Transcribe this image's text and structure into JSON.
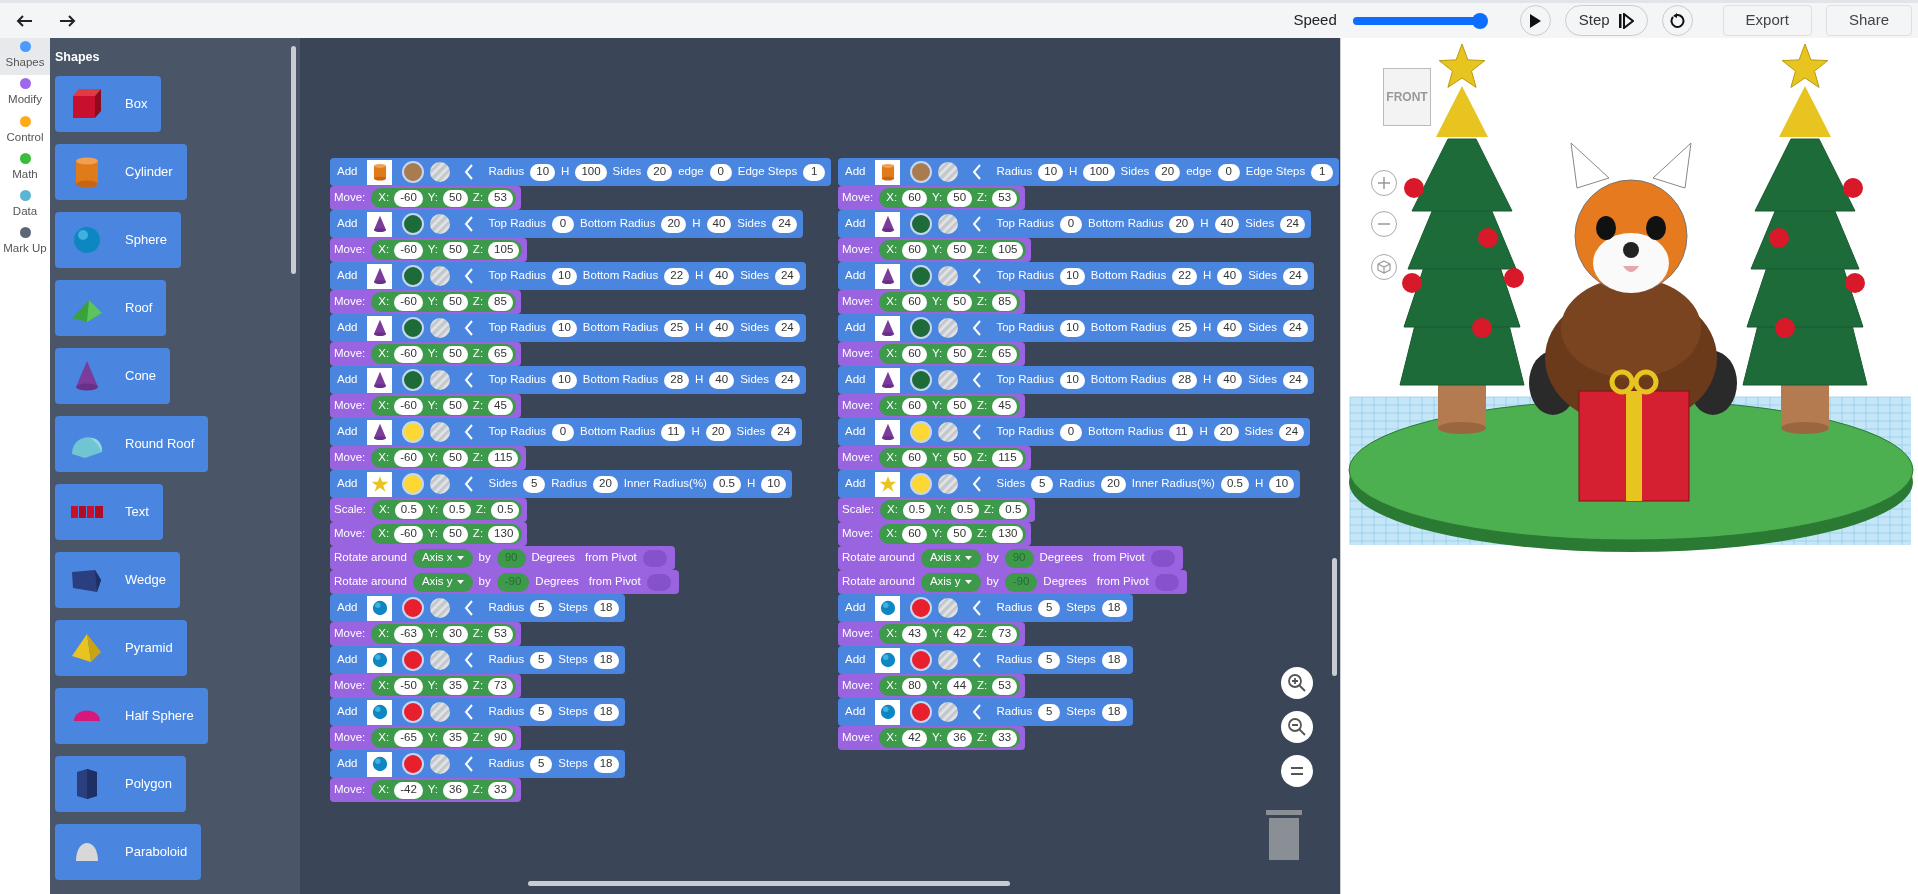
{
  "toolbar": {
    "speed": {
      "label": "Speed",
      "level": 1
    },
    "step": {
      "label": "Step"
    },
    "export": {
      "label": "Export"
    },
    "share": {
      "label": "Share"
    }
  },
  "categories": [
    {
      "label": "Shapes",
      "color": "#4c9aff",
      "selected": true
    },
    {
      "label": "Modify",
      "color": "#a066f0",
      "selected": false
    },
    {
      "label": "Control",
      "color": "#ffab19",
      "selected": false
    },
    {
      "label": "Math",
      "color": "#3dbb3d",
      "selected": false
    },
    {
      "label": "Data",
      "color": "#5bb5d5",
      "selected": false
    },
    {
      "label": "Mark Up",
      "color": "#5b6677",
      "selected": false
    }
  ],
  "palette": {
    "title": "Shapes",
    "items": [
      {
        "label": "Box",
        "icon": {
          "kind": "box"
        }
      },
      {
        "label": "Cylinder",
        "icon": {
          "kind": "cylinder"
        }
      },
      {
        "label": "Sphere",
        "icon": {
          "kind": "sphere"
        }
      },
      {
        "label": "Roof",
        "icon": {
          "kind": "roof"
        }
      },
      {
        "label": "Cone",
        "icon": {
          "kind": "cone"
        }
      },
      {
        "label": "Round Roof",
        "icon": {
          "kind": "roundroof"
        }
      },
      {
        "label": "Text",
        "icon": {
          "kind": "text"
        }
      },
      {
        "label": "Wedge",
        "icon": {
          "kind": "wedge"
        }
      },
      {
        "label": "Pyramid",
        "icon": {
          "kind": "pyramid"
        }
      },
      {
        "label": "Half Sphere",
        "icon": {
          "kind": "halfsphere"
        }
      },
      {
        "label": "Polygon",
        "icon": {
          "kind": "polygon"
        }
      },
      {
        "label": "Paraboloid",
        "icon": {
          "kind": "paraboloid"
        }
      }
    ]
  },
  "stacks": [
    {
      "blocks": [
        {
          "kind": "add",
          "label": "Add",
          "thumbnail": {
            "kind": "cylinder"
          },
          "color": "#a97c50",
          "params": [
            {
              "label": "Radius",
              "value": "10"
            },
            {
              "label": "H",
              "value": "100"
            },
            {
              "label": "Sides",
              "value": "20"
            },
            {
              "label": "edge",
              "value": "0"
            },
            {
              "label": "Edge Steps",
              "value": "1"
            }
          ]
        },
        {
          "kind": "move",
          "label": "Move:",
          "fields": [
            {
              "label": "X:",
              "value": "-60"
            },
            {
              "label": "Y:",
              "value": "50"
            },
            {
              "label": "Z:",
              "value": "53"
            }
          ]
        },
        {
          "kind": "add",
          "label": "Add",
          "thumbnail": {
            "kind": "cone"
          },
          "color": "#1e6b3a",
          "params": [
            {
              "label": "Top Radius",
              "value": "0"
            },
            {
              "label": "Bottom Radius",
              "value": "20"
            },
            {
              "label": "H",
              "value": "40"
            },
            {
              "label": "Sides",
              "value": "24"
            }
          ]
        },
        {
          "kind": "move",
          "label": "Move:",
          "fields": [
            {
              "label": "X:",
              "value": "-60"
            },
            {
              "label": "Y:",
              "value": "50"
            },
            {
              "label": "Z:",
              "value": "105"
            }
          ]
        },
        {
          "kind": "add",
          "label": "Add",
          "thumbnail": {
            "kind": "cone"
          },
          "color": "#1e6b3a",
          "params": [
            {
              "label": "Top Radius",
              "value": "10"
            },
            {
              "label": "Bottom Radius",
              "value": "22"
            },
            {
              "label": "H",
              "value": "40"
            },
            {
              "label": "Sides",
              "value": "24"
            }
          ]
        },
        {
          "kind": "move",
          "label": "Move:",
          "fields": [
            {
              "label": "X:",
              "value": "-60"
            },
            {
              "label": "Y:",
              "value": "50"
            },
            {
              "label": "Z:",
              "value": "85"
            }
          ]
        },
        {
          "kind": "add",
          "label": "Add",
          "thumbnail": {
            "kind": "cone"
          },
          "color": "#1e6b3a",
          "params": [
            {
              "label": "Top Radius",
              "value": "10"
            },
            {
              "label": "Bottom Radius",
              "value": "25"
            },
            {
              "label": "H",
              "value": "40"
            },
            {
              "label": "Sides",
              "value": "24"
            }
          ]
        },
        {
          "kind": "move",
          "label": "Move:",
          "fields": [
            {
              "label": "X:",
              "value": "-60"
            },
            {
              "label": "Y:",
              "value": "50"
            },
            {
              "label": "Z:",
              "value": "65"
            }
          ]
        },
        {
          "kind": "add",
          "label": "Add",
          "thumbnail": {
            "kind": "cone"
          },
          "color": "#1e6b3a",
          "params": [
            {
              "label": "Top Radius",
              "value": "10"
            },
            {
              "label": "Bottom Radius",
              "value": "28"
            },
            {
              "label": "H",
              "value": "40"
            },
            {
              "label": "Sides",
              "value": "24"
            }
          ]
        },
        {
          "kind": "move",
          "label": "Move:",
          "fields": [
            {
              "label": "X:",
              "value": "-60"
            },
            {
              "label": "Y:",
              "value": "50"
            },
            {
              "label": "Z:",
              "value": "45"
            }
          ]
        },
        {
          "kind": "add",
          "label": "Add",
          "thumbnail": {
            "kind": "cone"
          },
          "color": "#fdd835",
          "params": [
            {
              "label": "Top Radius",
              "value": "0"
            },
            {
              "label": "Bottom Radius",
              "value": "11"
            },
            {
              "label": "H",
              "value": "20"
            },
            {
              "label": "Sides",
              "value": "24"
            }
          ]
        },
        {
          "kind": "move",
          "label": "Move:",
          "fields": [
            {
              "label": "X:",
              "value": "-60"
            },
            {
              "label": "Y:",
              "value": "50"
            },
            {
              "label": "Z:",
              "value": "115"
            }
          ]
        },
        {
          "kind": "add",
          "label": "Add",
          "thumbnail": {
            "kind": "star"
          },
          "color": "#fdd835",
          "params": [
            {
              "label": "Sides",
              "value": "5"
            },
            {
              "label": "Radius",
              "value": "20"
            },
            {
              "label": "Inner Radius(%)",
              "value": "0.5"
            },
            {
              "label": "H",
              "value": "10"
            }
          ]
        },
        {
          "kind": "move",
          "label": "Scale:",
          "fields": [
            {
              "label": "X:",
              "value": "0.5"
            },
            {
              "label": "Y:",
              "value": "0.5"
            },
            {
              "label": "Z:",
              "value": "0.5"
            }
          ]
        },
        {
          "kind": "move",
          "label": "Move:",
          "fields": [
            {
              "label": "X:",
              "value": "-60"
            },
            {
              "label": "Y:",
              "value": "50"
            },
            {
              "label": "Z:",
              "value": "130"
            }
          ]
        },
        {
          "kind": "rotate",
          "label": "Rotate around",
          "axis": "Axis x",
          "by": "by",
          "degrees": "90",
          "unit": "Degrees",
          "pivot": "from Pivot"
        },
        {
          "kind": "rotate",
          "label": "Rotate around",
          "axis": "Axis y",
          "by": "by",
          "degrees": "-90",
          "unit": "Degrees",
          "pivot": "from Pivot"
        },
        {
          "kind": "add",
          "label": "Add",
          "thumbnail": {
            "kind": "sphere"
          },
          "color": "#e8202e",
          "params": [
            {
              "label": "Radius",
              "value": "5"
            },
            {
              "label": "Steps",
              "value": "18"
            }
          ]
        },
        {
          "kind": "move",
          "label": "Move:",
          "fields": [
            {
              "label": "X:",
              "value": "-63"
            },
            {
              "label": "Y:",
              "value": "30"
            },
            {
              "label": "Z:",
              "value": "53"
            }
          ]
        },
        {
          "kind": "add",
          "label": "Add",
          "thumbnail": {
            "kind": "sphere"
          },
          "color": "#e8202e",
          "params": [
            {
              "label": "Radius",
              "value": "5"
            },
            {
              "label": "Steps",
              "value": "18"
            }
          ]
        },
        {
          "kind": "move",
          "label": "Move:",
          "fields": [
            {
              "label": "X:",
              "value": "-50"
            },
            {
              "label": "Y:",
              "value": "35"
            },
            {
              "label": "Z:",
              "value": "73"
            }
          ]
        },
        {
          "kind": "add",
          "label": "Add",
          "thumbnail": {
            "kind": "sphere"
          },
          "color": "#e8202e",
          "params": [
            {
              "label": "Radius",
              "value": "5"
            },
            {
              "label": "Steps",
              "value": "18"
            }
          ]
        },
        {
          "kind": "move",
          "label": "Move:",
          "fields": [
            {
              "label": "X:",
              "value": "-65"
            },
            {
              "label": "Y:",
              "value": "35"
            },
            {
              "label": "Z:",
              "value": "90"
            }
          ]
        },
        {
          "kind": "add",
          "label": "Add",
          "thumbnail": {
            "kind": "sphere"
          },
          "color": "#e8202e",
          "params": [
            {
              "label": "Radius",
              "value": "5"
            },
            {
              "label": "Steps",
              "value": "18"
            }
          ]
        },
        {
          "kind": "move",
          "label": "Move:",
          "fields": [
            {
              "label": "X:",
              "value": "-42"
            },
            {
              "label": "Y:",
              "value": "36"
            },
            {
              "label": "Z:",
              "value": "33"
            }
          ]
        }
      ]
    },
    {
      "blocks": [
        {
          "kind": "add",
          "label": "Add",
          "thumbnail": {
            "kind": "cylinder"
          },
          "color": "#a97c50",
          "params": [
            {
              "label": "Radius",
              "value": "10"
            },
            {
              "label": "H",
              "value": "100"
            },
            {
              "label": "Sides",
              "value": "20"
            },
            {
              "label": "edge",
              "value": "0"
            },
            {
              "label": "Edge Steps",
              "value": "1"
            }
          ]
        },
        {
          "kind": "move",
          "label": "Move:",
          "fields": [
            {
              "label": "X:",
              "value": "60"
            },
            {
              "label": "Y:",
              "value": "50"
            },
            {
              "label": "Z:",
              "value": "53"
            }
          ]
        },
        {
          "kind": "add",
          "label": "Add",
          "thumbnail": {
            "kind": "cone"
          },
          "color": "#1e6b3a",
          "params": [
            {
              "label": "Top Radius",
              "value": "0"
            },
            {
              "label": "Bottom Radius",
              "value": "20"
            },
            {
              "label": "H",
              "value": "40"
            },
            {
              "label": "Sides",
              "value": "24"
            }
          ]
        },
        {
          "kind": "move",
          "label": "Move:",
          "fields": [
            {
              "label": "X:",
              "value": "60"
            },
            {
              "label": "Y:",
              "value": "50"
            },
            {
              "label": "Z:",
              "value": "105"
            }
          ]
        },
        {
          "kind": "add",
          "label": "Add",
          "thumbnail": {
            "kind": "cone"
          },
          "color": "#1e6b3a",
          "params": [
            {
              "label": "Top Radius",
              "value": "10"
            },
            {
              "label": "Bottom Radius",
              "value": "22"
            },
            {
              "label": "H",
              "value": "40"
            },
            {
              "label": "Sides",
              "value": "24"
            }
          ]
        },
        {
          "kind": "move",
          "label": "Move:",
          "fields": [
            {
              "label": "X:",
              "value": "60"
            },
            {
              "label": "Y:",
              "value": "50"
            },
            {
              "label": "Z:",
              "value": "85"
            }
          ]
        },
        {
          "kind": "add",
          "label": "Add",
          "thumbnail": {
            "kind": "cone"
          },
          "color": "#1e6b3a",
          "params": [
            {
              "label": "Top Radius",
              "value": "10"
            },
            {
              "label": "Bottom Radius",
              "value": "25"
            },
            {
              "label": "H",
              "value": "40"
            },
            {
              "label": "Sides",
              "value": "24"
            }
          ]
        },
        {
          "kind": "move",
          "label": "Move:",
          "fields": [
            {
              "label": "X:",
              "value": "60"
            },
            {
              "label": "Y:",
              "value": "50"
            },
            {
              "label": "Z:",
              "value": "65"
            }
          ]
        },
        {
          "kind": "add",
          "label": "Add",
          "thumbnail": {
            "kind": "cone"
          },
          "color": "#1e6b3a",
          "params": [
            {
              "label": "Top Radius",
              "value": "10"
            },
            {
              "label": "Bottom Radius",
              "value": "28"
            },
            {
              "label": "H",
              "value": "40"
            },
            {
              "label": "Sides",
              "value": "24"
            }
          ]
        },
        {
          "kind": "move",
          "label": "Move:",
          "fields": [
            {
              "label": "X:",
              "value": "60"
            },
            {
              "label": "Y:",
              "value": "50"
            },
            {
              "label": "Z:",
              "value": "45"
            }
          ]
        },
        {
          "kind": "add",
          "label": "Add",
          "thumbnail": {
            "kind": "cone"
          },
          "color": "#fdd835",
          "params": [
            {
              "label": "Top Radius",
              "value": "0"
            },
            {
              "label": "Bottom Radius",
              "value": "11"
            },
            {
              "label": "H",
              "value": "20"
            },
            {
              "label": "Sides",
              "value": "24"
            }
          ]
        },
        {
          "kind": "move",
          "label": "Move:",
          "fields": [
            {
              "label": "X:",
              "value": "60"
            },
            {
              "label": "Y:",
              "value": "50"
            },
            {
              "label": "Z:",
              "value": "115"
            }
          ]
        },
        {
          "kind": "add",
          "label": "Add",
          "thumbnail": {
            "kind": "star"
          },
          "color": "#fdd835",
          "params": [
            {
              "label": "Sides",
              "value": "5"
            },
            {
              "label": "Radius",
              "value": "20"
            },
            {
              "label": "Inner Radius(%)",
              "value": "0.5"
            },
            {
              "label": "H",
              "value": "10"
            }
          ]
        },
        {
          "kind": "move",
          "label": "Scale:",
          "fields": [
            {
              "label": "X:",
              "value": "0.5"
            },
            {
              "label": "Y:",
              "value": "0.5"
            },
            {
              "label": "Z:",
              "value": "0.5"
            }
          ]
        },
        {
          "kind": "move",
          "label": "Move:",
          "fields": [
            {
              "label": "X:",
              "value": "60"
            },
            {
              "label": "Y:",
              "value": "50"
            },
            {
              "label": "Z:",
              "value": "130"
            }
          ]
        },
        {
          "kind": "rotate",
          "label": "Rotate around",
          "axis": "Axis x",
          "by": "by",
          "degrees": "90",
          "unit": "Degrees",
          "pivot": "from Pivot"
        },
        {
          "kind": "rotate",
          "label": "Rotate around",
          "axis": "Axis y",
          "by": "by",
          "degrees": "-90",
          "unit": "Degrees",
          "pivot": "from Pivot"
        },
        {
          "kind": "add",
          "label": "Add",
          "thumbnail": {
            "kind": "sphere"
          },
          "color": "#e8202e",
          "params": [
            {
              "label": "Radius",
              "value": "5"
            },
            {
              "label": "Steps",
              "value": "18"
            }
          ]
        },
        {
          "kind": "move",
          "label": "Move:",
          "fields": [
            {
              "label": "X:",
              "value": "43"
            },
            {
              "label": "Y:",
              "value": "42"
            },
            {
              "label": "Z:",
              "value": "73"
            }
          ]
        },
        {
          "kind": "add",
          "label": "Add",
          "thumbnail": {
            "kind": "sphere"
          },
          "color": "#e8202e",
          "params": [
            {
              "label": "Radius",
              "value": "5"
            },
            {
              "label": "Steps",
              "value": "18"
            }
          ]
        },
        {
          "kind": "move",
          "label": "Move:",
          "fields": [
            {
              "label": "X:",
              "value": "80"
            },
            {
              "label": "Y:",
              "value": "44"
            },
            {
              "label": "Z:",
              "value": "53"
            }
          ]
        },
        {
          "kind": "add",
          "label": "Add",
          "thumbnail": {
            "kind": "sphere"
          },
          "color": "#e8202e",
          "params": [
            {
              "label": "Radius",
              "value": "5"
            },
            {
              "label": "Steps",
              "value": "18"
            }
          ]
        },
        {
          "kind": "move",
          "label": "Move:",
          "fields": [
            {
              "label": "X:",
              "value": "42"
            },
            {
              "label": "Y:",
              "value": "36"
            },
            {
              "label": "Z:",
              "value": "33"
            }
          ]
        }
      ]
    }
  ],
  "viewport": {
    "view_cube": {
      "label": "FRONT"
    }
  }
}
